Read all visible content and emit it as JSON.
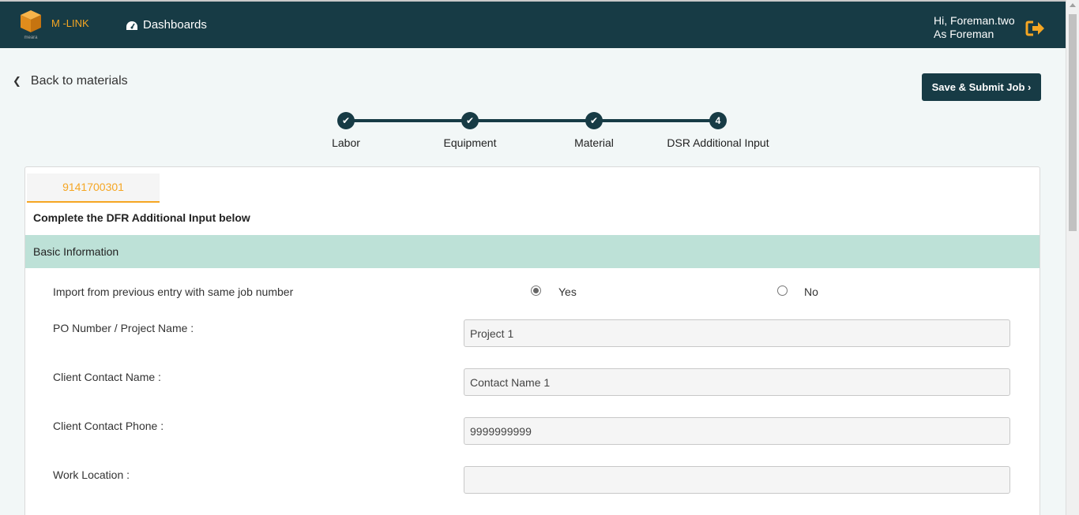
{
  "header": {
    "brand": "M -LINK",
    "logo_text": "meara",
    "nav_label": "Dashboards",
    "greeting_line1": "Hi, Foreman.two",
    "greeting_line2": "As Foreman"
  },
  "nav": {
    "back_label": "Back to materials",
    "submit_label": "Save & Submit Job"
  },
  "stepper": {
    "steps": [
      {
        "label": "Labor",
        "state": "complete"
      },
      {
        "label": "Equipment",
        "state": "complete"
      },
      {
        "label": "Material",
        "state": "complete"
      },
      {
        "label": "DSR Additional Input",
        "state": "current",
        "number": "4"
      }
    ]
  },
  "card": {
    "tab_label": "9141700301",
    "instruction": "Complete the DFR Additional Input below",
    "section_title": "Basic Information",
    "import_question": "Import from previous entry with same job number",
    "import_options": {
      "yes": "Yes",
      "no": "No",
      "selected": "yes"
    },
    "fields": [
      {
        "label": "PO Number / Project Name :",
        "value": "Project 1"
      },
      {
        "label": "Client Contact Name :",
        "value": "Contact Name 1"
      },
      {
        "label": "Client Contact Phone :",
        "value": "9999999999"
      },
      {
        "label": "Work Location :",
        "value": ""
      }
    ]
  },
  "colors": {
    "header_bg": "#173b45",
    "accent": "#f5a623",
    "section_band": "#bde1d7"
  }
}
